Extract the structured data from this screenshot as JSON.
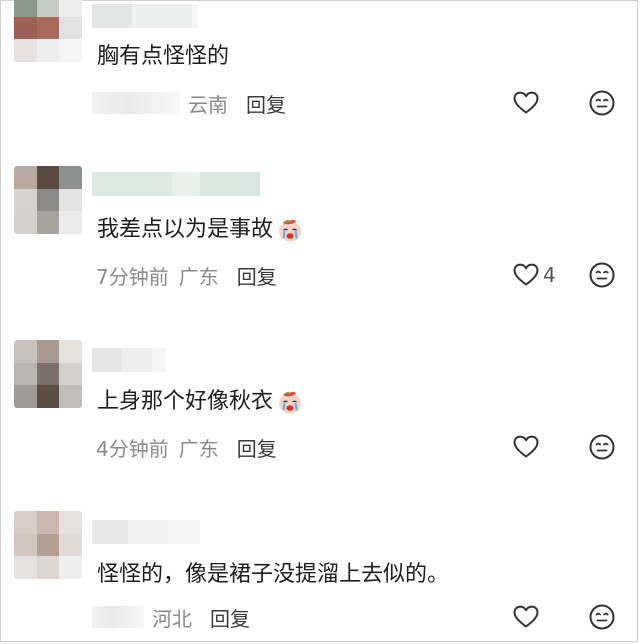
{
  "comments": [
    {
      "text": "胸有点怪怪的",
      "time": "",
      "region": "云南",
      "reply_label": "回复",
      "like_count": "",
      "has_emoji": false,
      "avatar_colors": [
        "#8a9a8a",
        "#c6ccc6",
        "#eeeeee",
        "#9b6156",
        "#a86a5c",
        "#e2e2e2",
        "#e6e0df",
        "#eeeeee",
        "#f4f4f4"
      ],
      "name_blur": [
        "#e3e6e4",
        "#eef0ef",
        "#f5f6f5"
      ]
    },
    {
      "text": "我差点以为是事故",
      "time": "7分钟前",
      "region": "广东",
      "reply_label": "回复",
      "like_count": "4",
      "has_emoji": true,
      "avatar_colors": [
        "#b8aaa0",
        "#5a4a40",
        "#8e9090",
        "#d9d3ce",
        "#8c8a86",
        "#e3e3e3",
        "#d6d0cc",
        "#a6a29e",
        "#eaeaea"
      ],
      "name_blur": [
        "#dce8e2",
        "#e8f0ec",
        "#d7e6de"
      ]
    },
    {
      "text": "上身那个好像秋衣",
      "time": "4分钟前",
      "region": "广东",
      "reply_label": "回复",
      "like_count": "",
      "has_emoji": true,
      "avatar_colors": [
        "#c9c2bc",
        "#a89a90",
        "#e4e0dc",
        "#bcb6b0",
        "#7c7068",
        "#d4d0cc",
        "#a09a95",
        "#5c4d44",
        "#c0bcb8"
      ],
      "name_blur": [
        "#e6e6e6",
        "#efefef",
        "#f5f5f5"
      ]
    },
    {
      "text": "怪怪的，像是裙子没提溜上去似的。",
      "time": "",
      "region": "河北",
      "reply_label": "回复",
      "like_count": "",
      "has_emoji": false,
      "avatar_colors": [
        "#d8ccc6",
        "#c8b8ae",
        "#e6e0dc",
        "#d4c6be",
        "#b29e92",
        "#e0dad6",
        "#e6e2df",
        "#ddd5d0",
        "#eeeeee"
      ],
      "name_blur": [
        "#e8e8e8",
        "#f0f0f0",
        "#f4f4f4"
      ]
    }
  ],
  "icons": {
    "like": "heart-outline-icon",
    "reaction": "smiley-face-icon",
    "emoji": "crying-face-emoji"
  },
  "colors": {
    "text": "#1e1e1e",
    "meta": "#8a8a8a",
    "icon": "#333333"
  }
}
